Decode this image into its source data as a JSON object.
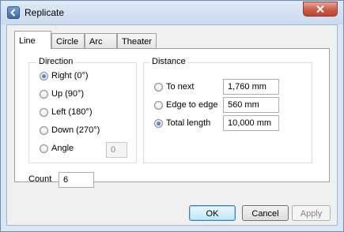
{
  "window": {
    "title": "Replicate"
  },
  "tabs": [
    {
      "label": "Line",
      "active": true
    },
    {
      "label": "Circle",
      "active": false
    },
    {
      "label": "Arc",
      "active": false
    },
    {
      "label": "Theater",
      "active": false
    }
  ],
  "direction": {
    "legend": "Direction",
    "options": [
      {
        "label": "Right (0°)",
        "checked": true
      },
      {
        "label": "Up (90°)",
        "checked": false
      },
      {
        "label": "Left (180°)",
        "checked": false
      },
      {
        "label": "Down (270°)",
        "checked": false
      },
      {
        "label": "Angle",
        "checked": false
      }
    ],
    "angle_value": "0"
  },
  "distance": {
    "legend": "Distance",
    "options": [
      {
        "label": "To next",
        "value": "1,760 mm",
        "checked": false
      },
      {
        "label": "Edge to edge",
        "value": "560 mm",
        "checked": false
      },
      {
        "label": "Total length",
        "value": "10,000 mm",
        "checked": true
      }
    ]
  },
  "count": {
    "label": "Count",
    "value": "6"
  },
  "buttons": {
    "ok": "OK",
    "cancel": "Cancel",
    "apply": "Apply"
  },
  "colors": {
    "accent": "#3c7fb1",
    "close": "#c75c4b",
    "frame": "#dbe6f3"
  },
  "icons": {
    "app": "back-arrow-icon",
    "close": "close-icon"
  }
}
